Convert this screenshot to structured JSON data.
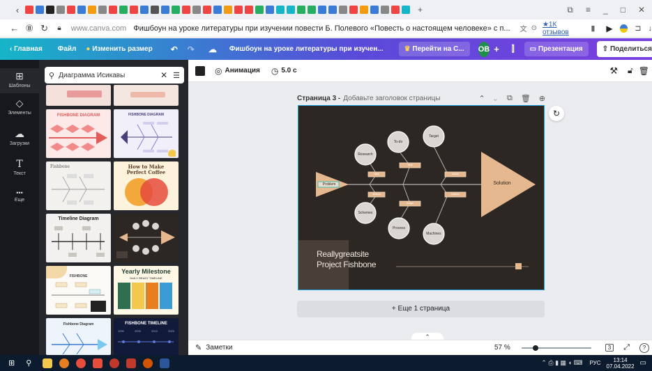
{
  "browser": {
    "tab_controls": {
      "new_tab": "+",
      "window_ctrl": "⧉",
      "menu": "≡",
      "minimize": "_",
      "maximize": "□",
      "close": "✕"
    },
    "address": {
      "domain": "www.canva.com",
      "title": "Фишбоун на уроке литературы при изучении повести Б. Полевого «Повесть о настоящем человеке» с п...",
      "reviews": "★1К отзывов"
    }
  },
  "canva_header": {
    "home": "Главная",
    "file": "Файл",
    "resize": "Изменить размер",
    "doc_title": "Фишбоун на уроке литературы при изучен...",
    "upgrade": "Перейти на С...",
    "avatar": "OB",
    "present": "Презентация",
    "share": "Поделиться"
  },
  "rail": [
    {
      "label": "Шаблоны",
      "icon": "⊞"
    },
    {
      "label": "Элементы",
      "icon": "◇"
    },
    {
      "label": "Загрузки",
      "icon": "☁"
    },
    {
      "label": "Текст",
      "icon": "T"
    },
    {
      "label": "Еще",
      "icon": "•••"
    }
  ],
  "search": {
    "value": "Диаграмма Исикавы"
  },
  "templates": {
    "t1": "FISHBONE DIAGRAM",
    "t2": "FISHBONE DIAGRAM",
    "t3": "Fishbone",
    "t4": "How to Make Perfect Coffee",
    "t5": "Timeline Diagram",
    "t7": "FISHBONE",
    "t8": "Yearly Milestone",
    "t8_sub": "DAILY READY TIMELINE",
    "t9": "Fishbone Diagram",
    "t10": "FISHBONE TIMELINE",
    "t10_years": [
      "1990",
      "2000",
      "2010",
      "2020"
    ]
  },
  "toolbar": {
    "animation": "Анимация",
    "duration": "5.0 с"
  },
  "page": {
    "label": "Страница 3 -",
    "placeholder": "Добавьте заголовок страницы"
  },
  "fishbone": {
    "problem": "Problem",
    "solution": "Solution",
    "top_nodes": [
      "Research",
      "To-do",
      "Target"
    ],
    "bottom_nodes": [
      "Schemes",
      "Process",
      "Machines"
    ],
    "tags": [
      "Idea",
      "Task",
      "Action",
      "Method",
      "Scope",
      "Opinion"
    ],
    "brand_line1": "Reallygreatsite",
    "brand_line2": "Project Fishbone"
  },
  "add_page": "+ Еще 1 страница",
  "bottom": {
    "notes": "Заметки",
    "zoom": "57 %",
    "zoom_fraction": 0.2,
    "page_count": "3"
  },
  "taskbar": {
    "lang": "РУС",
    "time": "13:14",
    "date": "07.04.2022"
  },
  "colors": {
    "slide_bg": "#2d2723",
    "peach": "#e6b88f",
    "node": "#d9d6d3",
    "accent_bar": "#16b5c8"
  }
}
